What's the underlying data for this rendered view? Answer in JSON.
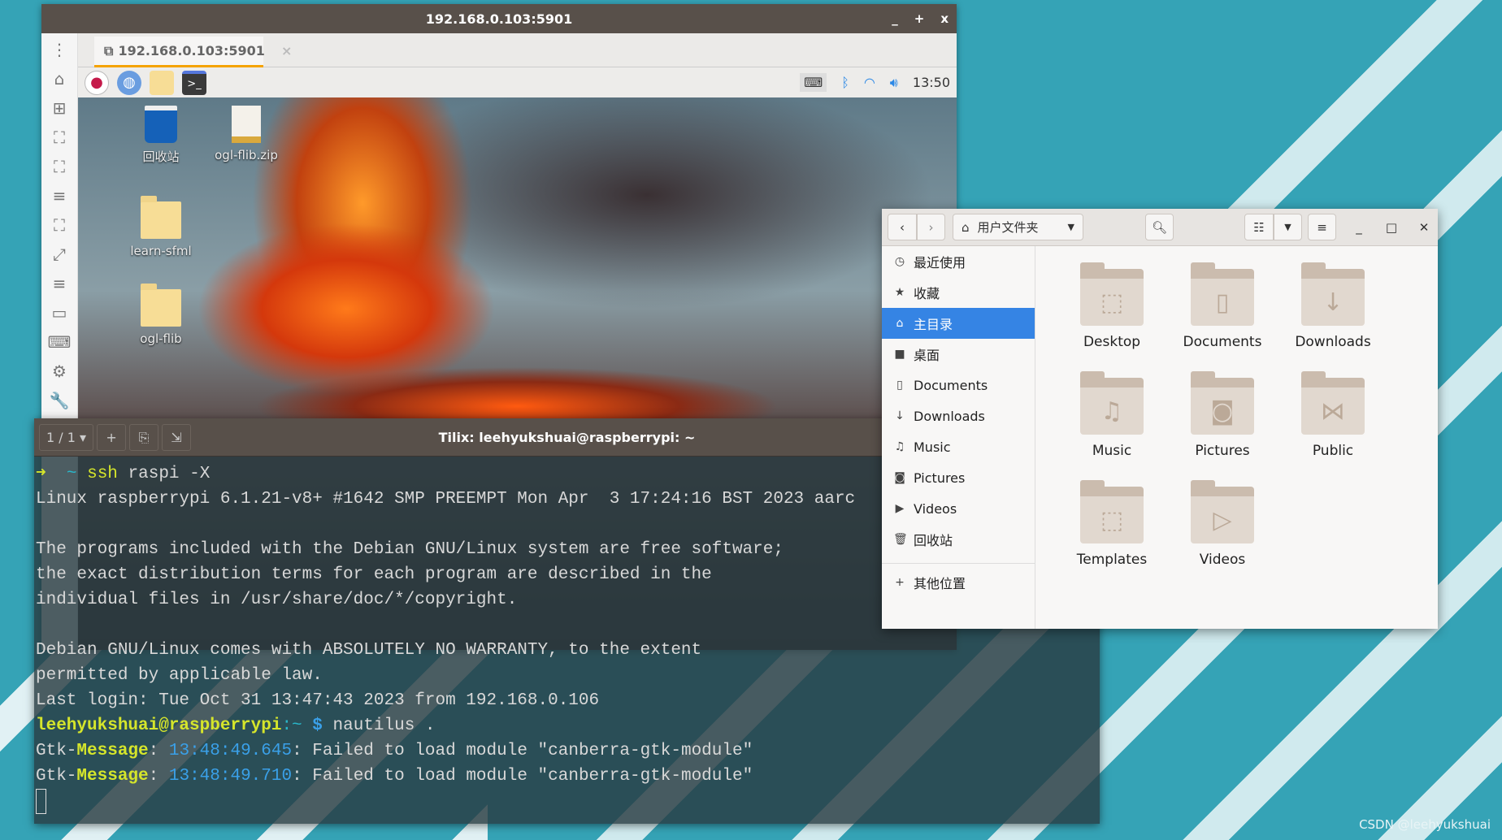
{
  "vnc": {
    "title": "192.168.0.103:5901",
    "controls": [
      "_",
      "+",
      "x"
    ],
    "tab": {
      "label": "192.168.0.103:5901",
      "close": "×"
    },
    "panel": {
      "clock": "13:50",
      "tray": [
        "keyboard-icon",
        "bluetooth-icon",
        "wifi-icon",
        "volume-icon"
      ]
    },
    "desktop_icons": [
      {
        "label": "回收站"
      },
      {
        "label": "ogl-flib.zip"
      },
      {
        "label": "learn-sfml"
      },
      {
        "label": "ogl-flib"
      }
    ]
  },
  "terminal": {
    "title": "Tilix: leehyukshuai@raspberrypi: ~",
    "session": "1 / 1 ▾",
    "buttons": [
      "+",
      "⎘",
      "⇲"
    ],
    "lines": {
      "prompt_arrow": "➜",
      "prompt_dir": "~",
      "cmd1": "ssh",
      "cmd1_args": " raspi -X",
      "l2": "Linux raspberrypi 6.1.21-v8+ #1642 SMP PREEMPT Mon Apr  3 17:24:16 BST 2023 aarc",
      "l4": "The programs included with the Debian GNU/Linux system are free software;",
      "l5": "the exact distribution terms for each program are described in the",
      "l6": "individual files in /usr/share/doc/*/copyright.",
      "l8": "Debian GNU/Linux comes with ABSOLUTELY NO WARRANTY, to the extent",
      "l9": "permitted by applicable law.",
      "l10": "Last login: Tue Oct 31 13:47:43 2023 from 192.168.0.106",
      "ps1_user": "leehyukshuai@raspberrypi",
      ":": ":~",
      "ps1_sym": " $",
      "cmd2": " nautilus .",
      "gtk": "Gtk-",
      "msg": "Message",
      "t1": "13:48:49.645",
      "t2": "13:48:49.710",
      "fail": ": Failed to load module \"canberra-gtk-module\""
    }
  },
  "files": {
    "location": "用户文件夹",
    "sidebar": [
      {
        "icon": "clock-icon",
        "label": "最近使用"
      },
      {
        "icon": "star-icon",
        "label": "收藏"
      },
      {
        "icon": "home-icon",
        "label": "主目录",
        "active": true
      },
      {
        "icon": "folder-icon",
        "label": "桌面"
      },
      {
        "icon": "document-icon",
        "label": "Documents"
      },
      {
        "icon": "download-icon",
        "label": "Downloads"
      },
      {
        "icon": "music-icon",
        "label": "Music"
      },
      {
        "icon": "camera-icon",
        "label": "Pictures"
      },
      {
        "icon": "video-icon",
        "label": "Videos"
      },
      {
        "icon": "trash-icon",
        "label": "回收站"
      },
      {
        "icon": "plus-icon",
        "label": "其他位置"
      }
    ],
    "folders": [
      {
        "label": "Desktop"
      },
      {
        "label": "Documents"
      },
      {
        "label": "Downloads"
      },
      {
        "label": "Music"
      },
      {
        "label": "Pictures"
      },
      {
        "label": "Public"
      },
      {
        "label": "Templates"
      },
      {
        "label": "Videos"
      }
    ]
  },
  "watermark": "CSDN @leehyukshuai",
  "colors": {
    "accent": "#3584e4",
    "desktop_bg": "#35a3b6",
    "prompt_user": "#d5e52b",
    "timestamp": "#3aa0e8"
  }
}
